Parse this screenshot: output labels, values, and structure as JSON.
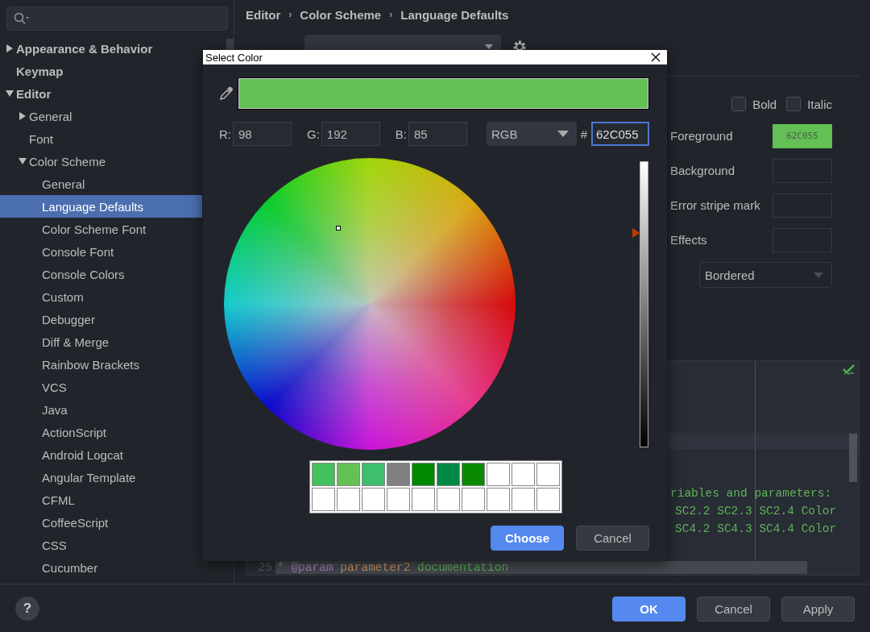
{
  "sidebar": {
    "items": [
      {
        "label": "Appearance & Behavior",
        "expanded": false,
        "selected": false
      },
      {
        "label": "Keymap",
        "selected": false
      },
      {
        "label": "Editor",
        "expanded": true,
        "selected": false,
        "children": [
          {
            "label": "General",
            "expanded": false,
            "selected": false
          },
          {
            "label": "Font",
            "selected": false
          },
          {
            "label": "Color Scheme",
            "expanded": true,
            "selected": false,
            "children": [
              {
                "label": "General",
                "selected": false
              },
              {
                "label": "Language Defaults",
                "selected": true
              },
              {
                "label": "Color Scheme Font",
                "selected": false
              },
              {
                "label": "Console Font",
                "selected": false
              },
              {
                "label": "Console Colors",
                "selected": false
              },
              {
                "label": "Custom",
                "selected": false
              },
              {
                "label": "Debugger",
                "selected": false
              },
              {
                "label": "Diff & Merge",
                "selected": false
              },
              {
                "label": "Rainbow Brackets",
                "selected": false
              },
              {
                "label": "VCS",
                "selected": false
              },
              {
                "label": "Java",
                "selected": false
              },
              {
                "label": "ActionScript",
                "selected": false
              },
              {
                "label": "Android Logcat",
                "selected": false
              },
              {
                "label": "Angular Template",
                "selected": false
              },
              {
                "label": "CFML",
                "selected": false
              },
              {
                "label": "CoffeeScript",
                "selected": false
              },
              {
                "label": "CSS",
                "selected": false
              },
              {
                "label": "Cucumber",
                "selected": false
              }
            ]
          }
        ]
      }
    ]
  },
  "breadcrumb": [
    {
      "label": "Editor"
    },
    {
      "separator": "›",
      "label": "Color Scheme"
    },
    {
      "separator": "›",
      "label": "Language Defaults"
    }
  ],
  "font_styles": [
    {
      "label": "Bold",
      "checked": false
    },
    {
      "label": "Italic",
      "checked": false
    }
  ],
  "attributes": [
    {
      "label": "Foreground",
      "value": "62C055",
      "color": "#62c055"
    },
    {
      "label": "Background"
    },
    {
      "label": "Error stripe mark"
    },
    {
      "label": "Effects"
    }
  ],
  "effect_type": "Bordered",
  "code_lines": [
    {
      "text": "riables and parameters:"
    },
    {
      "text": "SC2.2 SC2.3 SC2.4 Color"
    },
    {
      "text": "SC4.2 SC4.3 SC4.4 Color"
    }
  ],
  "code_line": {
    "number": "25",
    "tokens": [
      {
        "kind": "comment",
        "text": "* "
      },
      {
        "kind": "tag",
        "text": "@param"
      },
      {
        "kind": "param",
        "text": " parameter2"
      },
      {
        "kind": "comment",
        "text": " documentation"
      }
    ]
  },
  "dialog": {
    "title": "Select Color",
    "fields": [
      {
        "label": "R:",
        "value": "98"
      },
      {
        "label": "G:",
        "value": "192"
      },
      {
        "label": "B:",
        "value": "85"
      }
    ],
    "mode": "RGB",
    "hash": "#",
    "hex": "62C055",
    "brightness": {
      "level": 0.75
    },
    "swatches": [
      {
        "color": "#43c15d"
      },
      {
        "color": "#66c155"
      },
      {
        "color": "#3dbf6e"
      },
      {
        "color": "#808080"
      },
      {
        "color": "#008800"
      },
      {
        "color": "#008844"
      },
      {
        "color": "#0a8a00"
      },
      {
        "color": "#ffffff"
      },
      {
        "color": "#ffffff"
      },
      {
        "color": "#ffffff"
      },
      {
        "color": "#ffffff"
      },
      {
        "color": "#ffffff"
      },
      {
        "color": "#ffffff"
      },
      {
        "color": "#ffffff"
      },
      {
        "color": "#ffffff"
      },
      {
        "color": "#ffffff"
      },
      {
        "color": "#ffffff"
      },
      {
        "color": "#ffffff"
      },
      {
        "color": "#ffffff"
      },
      {
        "color": "#ffffff"
      }
    ],
    "buttons": [
      {
        "label": "Choose",
        "kind": "primary"
      },
      {
        "label": "Cancel",
        "kind": "secondary"
      }
    ]
  },
  "help": "?",
  "footer_buttons": [
    {
      "label": "OK",
      "kind": "primary"
    },
    {
      "label": "Cancel",
      "kind": "secondary"
    },
    {
      "label": "Apply",
      "kind": "secondary"
    }
  ]
}
